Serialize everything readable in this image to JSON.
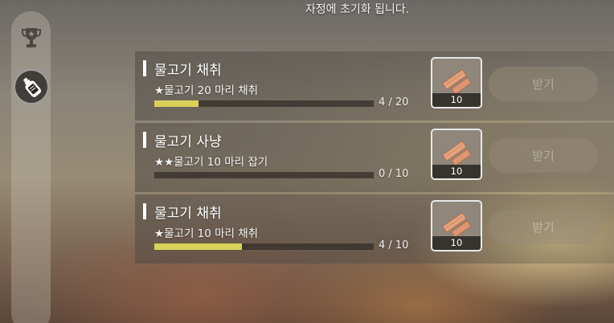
{
  "notice": "자정에 초기화 됩니다.",
  "sidebar": {
    "icons": [
      {
        "name": "trophy-icon"
      },
      {
        "name": "message-bottle-icon",
        "active": true
      }
    ]
  },
  "missions": [
    {
      "title": "물고기 채취",
      "desc": "★물고기 20 마리 채취",
      "progress": 4,
      "goal": 20,
      "count": "4 / 20",
      "reward_qty": "10",
      "claim": "받기"
    },
    {
      "title": "물고기 사냥",
      "desc": "★★물고기 10 마리 잡기",
      "progress": 0,
      "goal": 10,
      "count": "0 / 10",
      "reward_qty": "10",
      "claim": "받기"
    },
    {
      "title": "물고기 채취",
      "desc": "★물고기 10 마리 채취",
      "progress": 4,
      "goal": 10,
      "count": "4 / 10",
      "reward_qty": "10",
      "claim": "받기"
    }
  ],
  "colors": {
    "progress_fill": "#d8d25a",
    "claim_disabled": "#968c78"
  }
}
